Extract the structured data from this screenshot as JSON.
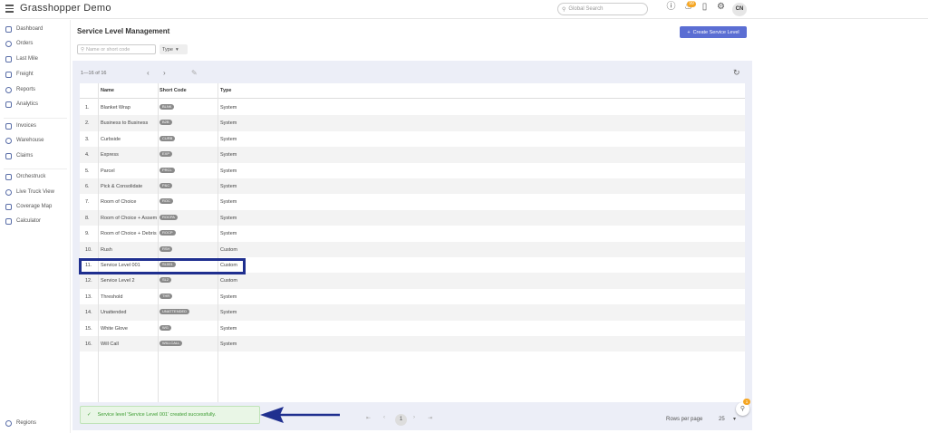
{
  "app": {
    "title": "Grasshopper Demo",
    "search_placeholder": "Global Search",
    "notification_count": "99",
    "avatar_initials": "CN"
  },
  "sidebar": {
    "items": [
      {
        "label": "Dashboard",
        "icon": "dashboard-icon"
      },
      {
        "label": "Orders",
        "icon": "orders-icon"
      },
      {
        "label": "Last Mile",
        "icon": "last-mile-icon"
      },
      {
        "label": "Freight",
        "icon": "freight-icon"
      },
      {
        "label": "Reports",
        "icon": "reports-icon"
      },
      {
        "label": "Analytics",
        "icon": "analytics-icon"
      },
      {
        "label": "Invoices",
        "icon": "invoices-icon"
      },
      {
        "label": "Warehouse",
        "icon": "warehouse-icon"
      },
      {
        "label": "Claims",
        "icon": "claims-icon"
      },
      {
        "label": "Orchestruck",
        "icon": "orchestruck-icon"
      },
      {
        "label": "Live Truck View",
        "icon": "live-truck-icon"
      },
      {
        "label": "Coverage Map",
        "icon": "coverage-map-icon"
      },
      {
        "label": "Calculator",
        "icon": "calculator-icon"
      }
    ],
    "footer_item": {
      "label": "Regions",
      "icon": "globe-icon"
    }
  },
  "main": {
    "title": "Service Level Management",
    "create_button": "Create Service Level",
    "filter_placeholder": "Name or short code",
    "type_filter": "Type",
    "range_text": "1—16 of 16",
    "columns": [
      "Name",
      "Short Code",
      "Type"
    ],
    "rows": [
      {
        "num": "1.",
        "name": "Blanket Wrap",
        "code": "BLNK",
        "type": "System"
      },
      {
        "num": "2.",
        "name": "Business to Business",
        "code": "B2B",
        "type": "System"
      },
      {
        "num": "3.",
        "name": "Curbside",
        "code": "CURB",
        "type": "System"
      },
      {
        "num": "4.",
        "name": "Express",
        "code": "EXP",
        "type": "System"
      },
      {
        "num": "5.",
        "name": "Parcel",
        "code": "PRCL",
        "type": "System"
      },
      {
        "num": "6.",
        "name": "Pick & Consolidate",
        "code": "P&C",
        "type": "System"
      },
      {
        "num": "7.",
        "name": "Room of Choice",
        "code": "ROC",
        "type": "System"
      },
      {
        "num": "8.",
        "name": "Room of Choice + Assembly",
        "code": "ROCPA",
        "type": "System"
      },
      {
        "num": "9.",
        "name": "Room of Choice + Debris",
        "code": "ROCP",
        "type": "System"
      },
      {
        "num": "10.",
        "name": "Rush",
        "code": "RSH",
        "type": "Custom"
      },
      {
        "num": "11.",
        "name": "Service Level 001",
        "code": "SL001",
        "type": "Custom"
      },
      {
        "num": "12.",
        "name": "Service Level 2",
        "code": "SL2",
        "type": "Custom"
      },
      {
        "num": "13.",
        "name": "Threshold",
        "code": "THR",
        "type": "System"
      },
      {
        "num": "14.",
        "name": "Unattended",
        "code": "UNATTENDED",
        "type": "System"
      },
      {
        "num": "15.",
        "name": "White Glove",
        "code": "WG",
        "type": "System"
      },
      {
        "num": "16.",
        "name": "Will Call",
        "code": "WILLCALL",
        "type": "System"
      }
    ],
    "highlighted_row": "11."
  },
  "footer": {
    "toast": "Service level 'Service Level 001' created successfully.",
    "current_page": "1",
    "rows_per_page_label": "Rows per page",
    "rows_per_page_value": "25",
    "help_badge": "1"
  },
  "colors": {
    "accent": "#5b6ed3",
    "highlight_border": "#1f2f8f",
    "success": "#3a9b2f",
    "badge": "#f5a623"
  }
}
